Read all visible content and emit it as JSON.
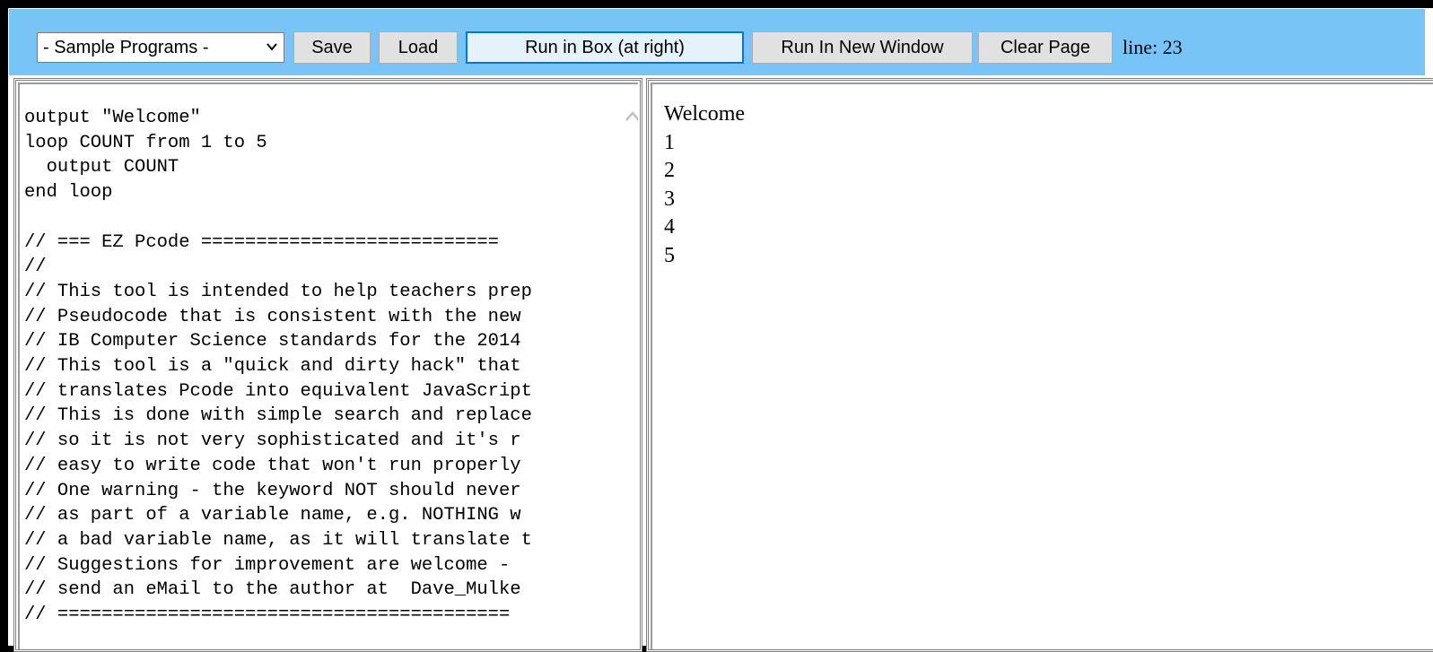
{
  "toolbar": {
    "select_value": "- Sample Programs -",
    "buttons": {
      "save": "Save",
      "load": "Load",
      "run_box": "Run in Box (at right)",
      "run_window": "Run In New Window",
      "clear": "Clear Page"
    },
    "line_label": "line: 23"
  },
  "editor": {
    "code_lines": [
      "output \"Welcome\"",
      "loop COUNT from 1 to 5",
      "  output COUNT",
      "end loop",
      "",
      "// === EZ Pcode ===========================",
      "//",
      "// This tool is intended to help teachers prep",
      "// Pseudocode that is consistent with the new",
      "// IB Computer Science standards for the 2014",
      "// This tool is a \"quick and dirty hack\" that",
      "// translates Pcode into equivalent JavaScript",
      "// This is done with simple search and replace",
      "// so it is not very sophisticated and it's r",
      "// easy to write code that won't run properly",
      "// One warning - the keyword NOT should never",
      "// as part of a variable name, e.g. NOTHING w",
      "// a bad variable name, as it will translate t",
      "// Suggestions for improvement are welcome -",
      "// send an eMail to the author at  Dave_Mulke",
      "// ========================================="
    ]
  },
  "output": {
    "lines": [
      "Welcome",
      "1",
      "2",
      "3",
      "4",
      "5"
    ]
  }
}
